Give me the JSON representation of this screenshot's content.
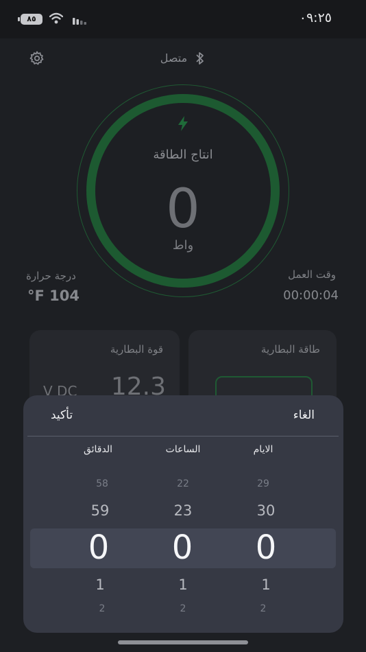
{
  "status_bar": {
    "time": "٠٩:٢٥",
    "battery": "٨٥"
  },
  "header": {
    "connection_status": "متصل"
  },
  "gauge": {
    "label": "انتاج الطاقة",
    "value": "0",
    "unit": "واط"
  },
  "stats": {
    "temperature_label": "درجة حرارة",
    "temperature_value": "°F 104",
    "runtime_label": "وقت العمل",
    "runtime_value": "00:00:04"
  },
  "cards": {
    "battery_voltage_title": "قوة البطارية",
    "battery_voltage_value": "12.3",
    "battery_voltage_unit": "V DC",
    "battery_energy_title": "طاقة البطارية"
  },
  "picker": {
    "confirm_label": "تأكيد",
    "cancel_label": "الغاء",
    "columns": [
      {
        "label": "الدقائق",
        "values": [
          "58",
          "59",
          "0",
          "1",
          "2"
        ]
      },
      {
        "label": "الساعات",
        "values": [
          "22",
          "23",
          "0",
          "1",
          "2"
        ]
      },
      {
        "label": "الايام",
        "values": [
          "29",
          "30",
          "0",
          "1",
          "2"
        ]
      }
    ]
  },
  "colors": {
    "accent_green": "#1d5a31",
    "sheet_bg": "#363944",
    "background": "#1f2125"
  }
}
